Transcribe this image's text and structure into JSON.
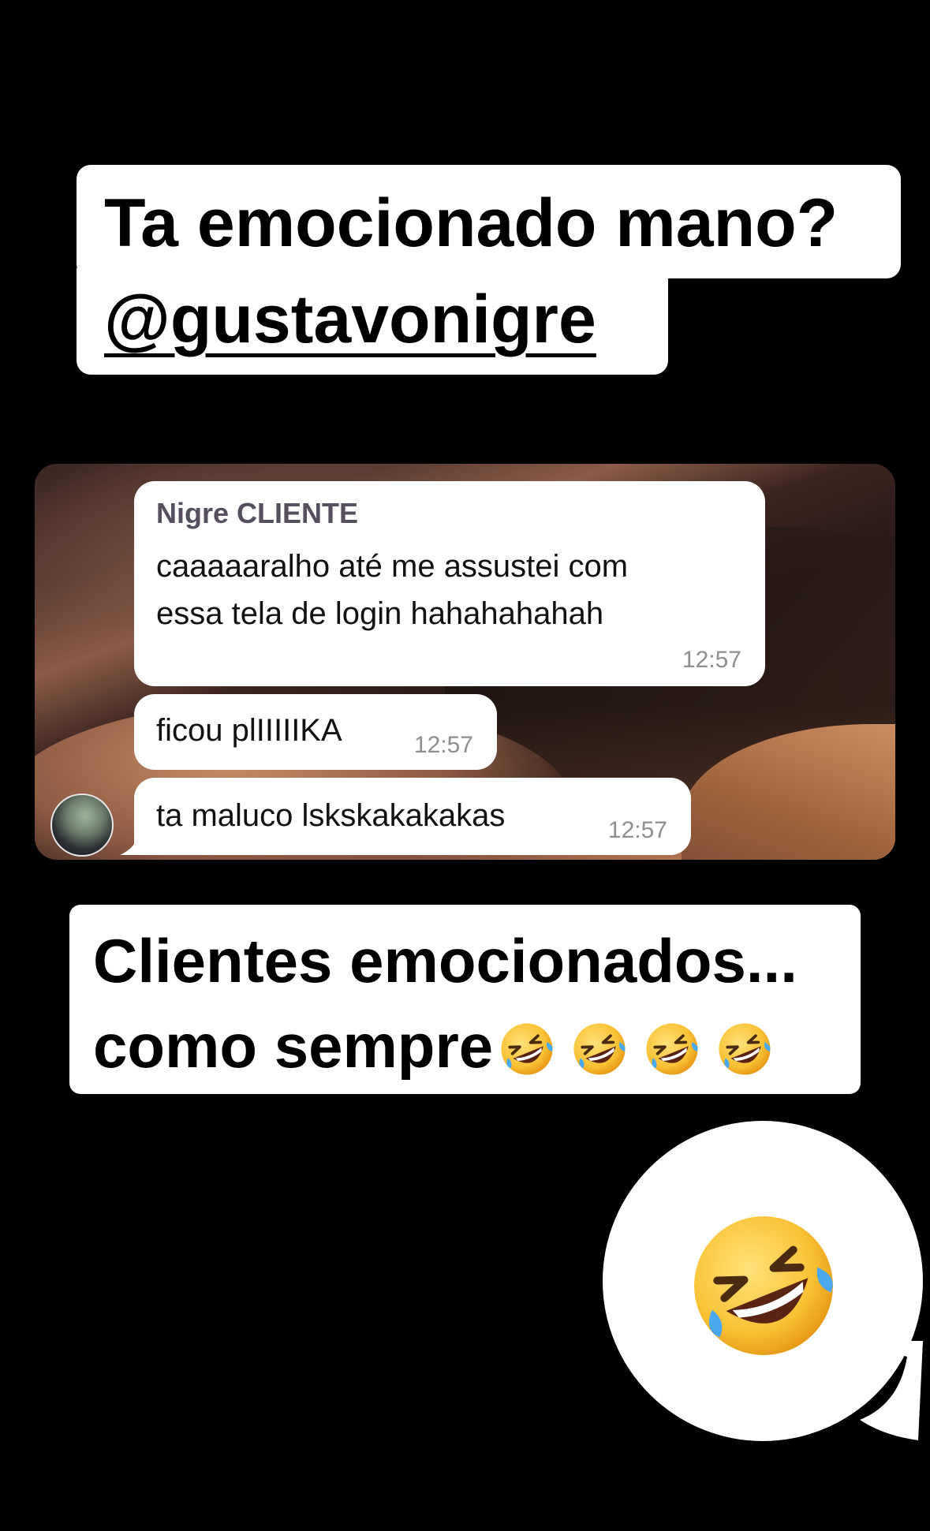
{
  "top_caption": {
    "line1": "Ta emocionado mano?",
    "line2": "@gustavonigre"
  },
  "chat": {
    "messages": [
      {
        "sender": "Nigre CLIENTE",
        "lines": [
          "caaaaaralho até me assustei com",
          "essa tela de login hahahahahah"
        ],
        "time": "12:57"
      },
      {
        "text": "ficou plIIIIIKA",
        "time": "12:57"
      },
      {
        "text": "ta maluco lskskakakakas",
        "time": "12:57"
      }
    ]
  },
  "bottom_caption": {
    "line1": "Clientes emocionados...",
    "line2": "como sempre",
    "emoji_icons": [
      "rofl-emoji",
      "rofl-emoji",
      "rofl-emoji",
      "rofl-emoji"
    ]
  },
  "sticker": {
    "icon": "rofl-emoji-icon"
  },
  "colors": {
    "background": "#000000",
    "caption_bg": "#ffffff",
    "sender_name": "#56505e",
    "timestamp": "#8e8e93"
  }
}
